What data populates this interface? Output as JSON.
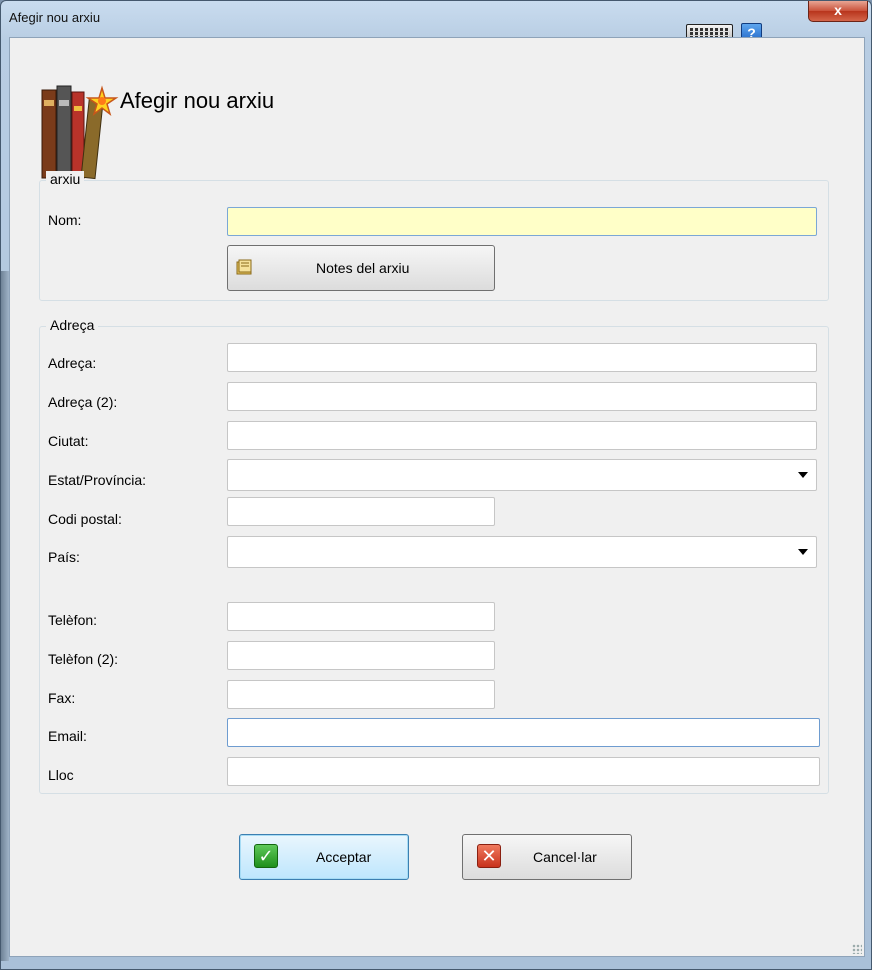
{
  "window": {
    "title": "Afegir nou arxiu",
    "close_glyph": "x",
    "help_glyph": "?",
    "icons": [
      "keyboard-icon",
      "help-icon",
      "close-icon"
    ]
  },
  "header": {
    "title": "Afegir nou arxiu",
    "icon": "books-icon"
  },
  "arxiu_group": {
    "legend": "arxiu",
    "nom_label": "Nom:",
    "nom_value": "",
    "notes_button": "Notes del arxiu",
    "notes_icon": "folder-icon"
  },
  "address_group": {
    "legend": "Adreça",
    "adreca_label": "Adreça:",
    "adreca2_label": "Adreça (2):",
    "ciutat_label": "Ciutat:",
    "estat_label": "Estat/Província:",
    "codi_label": "Codi postal:",
    "pais_label": "País:",
    "telefon_label": "Telèfon:",
    "telefon2_label": "Telèfon (2):",
    "fax_label": "Fax:",
    "email_label": "Email:",
    "lloc_label": "Lloc"
  },
  "buttons": {
    "ok": "Acceptar",
    "cancel": "Cancel·lar",
    "ok_glyph": "✓",
    "cancel_glyph": "✕"
  },
  "colors": {
    "nom_field_bg": "#ffffc8",
    "client_bg": "#f0f0f0",
    "close_red": "#c9513a"
  }
}
